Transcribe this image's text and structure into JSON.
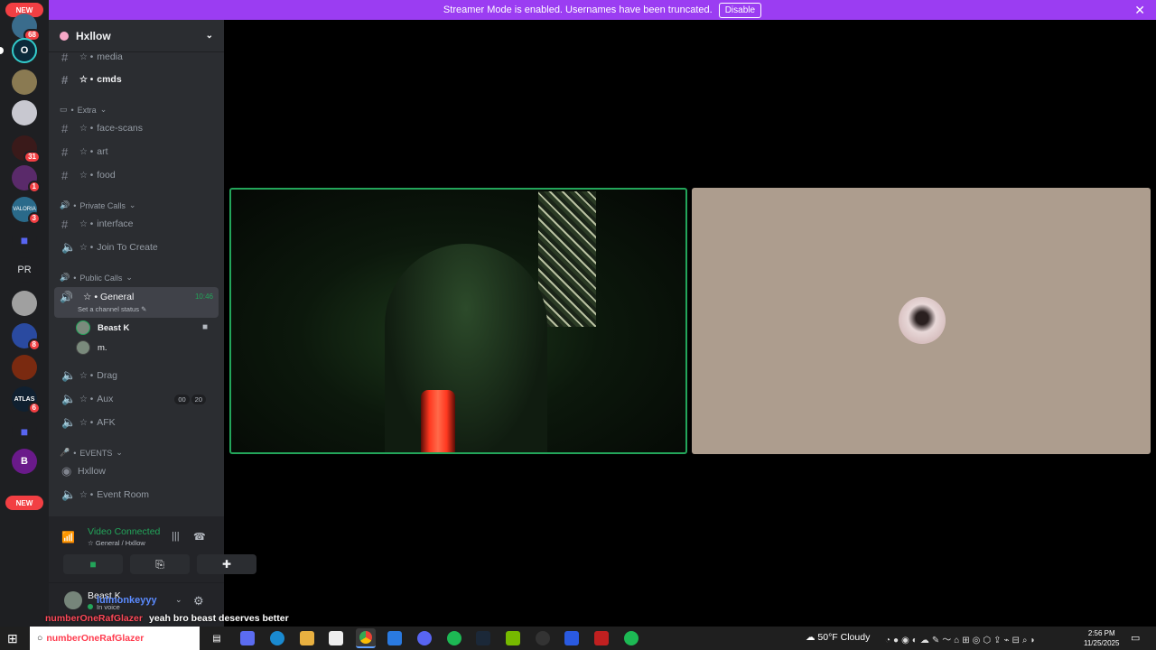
{
  "banner": {
    "text": "Streamer Mode is enabled. Usernames have been truncated.",
    "button": "Disable"
  },
  "rail": {
    "new_top": "NEW",
    "new_bottom": "NEW",
    "badges": [
      "68",
      "31",
      "1",
      "3",
      "8",
      "6"
    ],
    "pr_label": "PR"
  },
  "server": {
    "name": "Hxllow"
  },
  "channels": {
    "media": "media",
    "cmds": "cmds",
    "cat_extra": "Extra",
    "face_scans": "face-scans",
    "art": "art",
    "food": "food",
    "cat_private": "Private Calls",
    "interface": "interface",
    "join": "Join To Create",
    "cat_public": "Public Calls",
    "general": "General",
    "general_time": "10:46",
    "general_status": "Set a channel status",
    "voice_users": [
      "Beast K",
      "m."
    ],
    "drag": "Drag",
    "aux": "Aux",
    "aux_counts": [
      "00",
      "20"
    ],
    "afk": "AFK",
    "cat_events": "EVENTS",
    "hxllow": "Hxllow",
    "event_room": "Event Room"
  },
  "voice": {
    "status": "Video Connected",
    "location": "General / Hxllow"
  },
  "user": {
    "name": "Beast K",
    "status": "In voice"
  },
  "overlay": {
    "lulmon": "lulmonkeyyy",
    "chat_user": "numberOneRafGlazer",
    "chat_msg": "yeah bro beast deserves better"
  },
  "taskbar": {
    "search_text": "numberOneRafGlazer",
    "weather": "50°F  Cloudy",
    "time": "2:56 PM",
    "date": "11/25/2025"
  }
}
